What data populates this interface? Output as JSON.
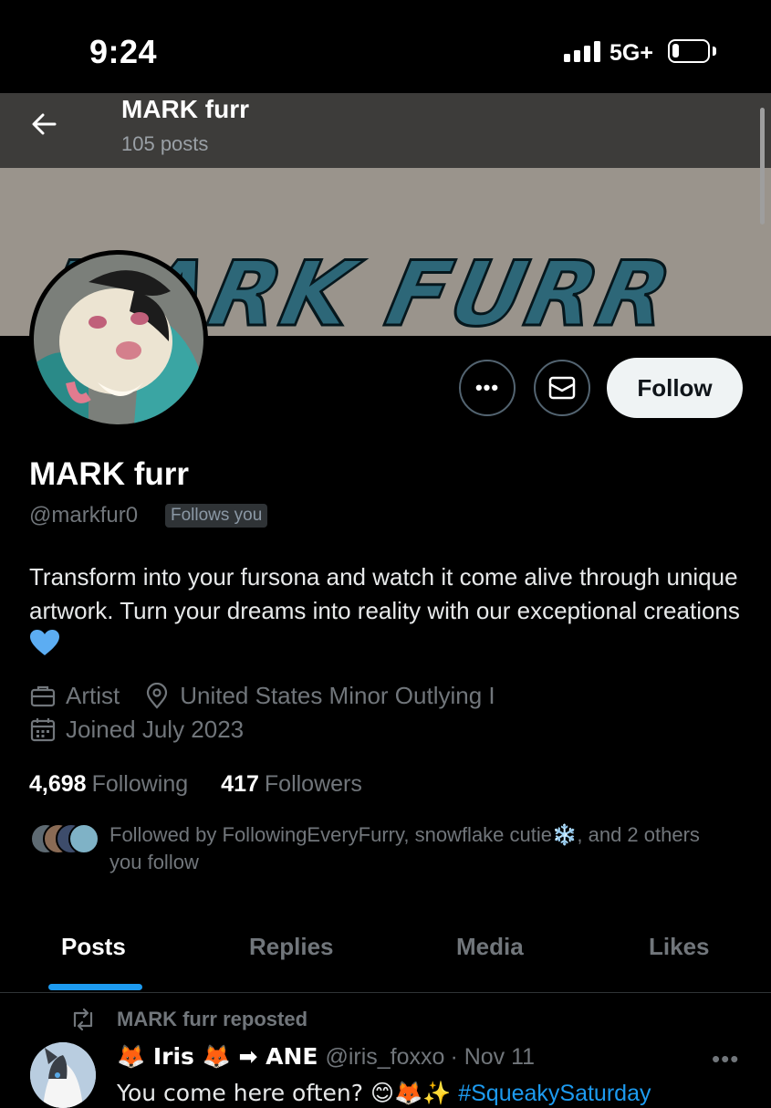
{
  "status_bar": {
    "time": "9:24",
    "network": "5G+"
  },
  "header": {
    "name": "MARK furr",
    "post_count": "105 posts",
    "banner_text": "MARK FURR"
  },
  "actions": {
    "more_label": "•••",
    "follow_label": "Follow"
  },
  "profile": {
    "display_name": "MARK furr",
    "handle": "@markfur0",
    "follows_you": "Follows you",
    "bio": "Transform into your fursona and watch it come alive through unique artwork. Turn your dreams into reality with our exceptional creations",
    "profession": "Artist",
    "location": "United States Minor Outlying I",
    "joined": "Joined July 2023",
    "following_count": "4,698",
    "following_label": "Following",
    "followers_count": "417",
    "followers_label": "Followers",
    "followed_by": "Followed by FollowingEveryFurry, snowflake cutie❄️, and 2 others you follow"
  },
  "tabs": [
    {
      "label": "Posts"
    },
    {
      "label": "Replies"
    },
    {
      "label": "Media"
    },
    {
      "label": "Likes"
    }
  ],
  "post": {
    "repost_label": "MARK furr reposted",
    "author": "🦊 Iris 🦊 ➡ ANE",
    "author_handle": "@iris_foxxo",
    "date": "· Nov 11",
    "text": "You come here often? 😊🦊✨ ",
    "hashtag": "#SqueakySaturday",
    "more": "•••"
  },
  "colors": {
    "accent": "#1d9bf0",
    "banner": "#9a948c",
    "banner_text": "#2d6778"
  }
}
